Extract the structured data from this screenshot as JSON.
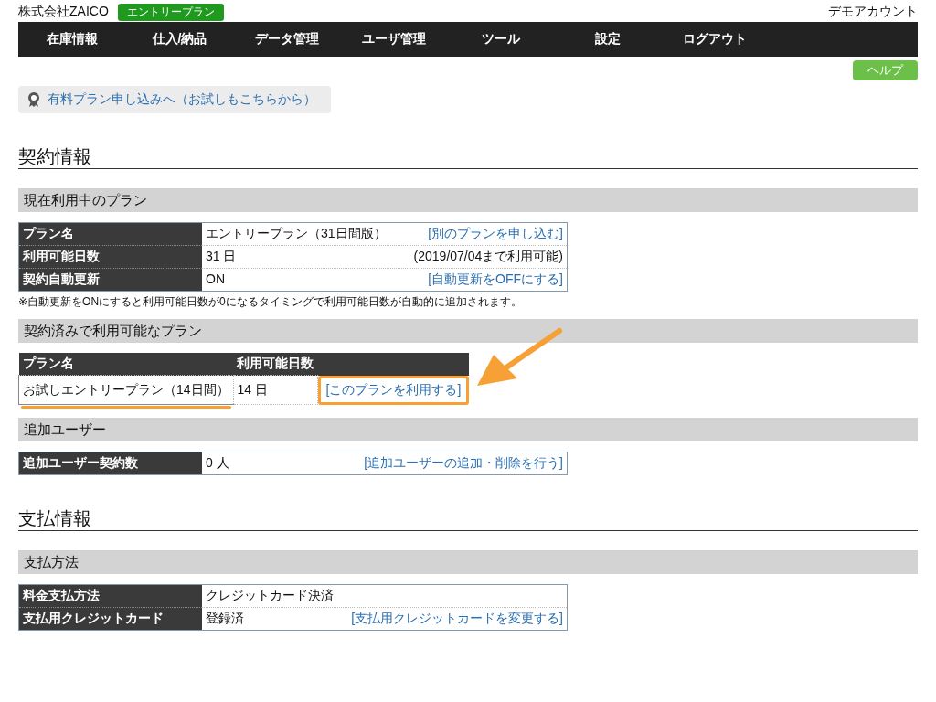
{
  "header": {
    "company": "株式会社ZAICO",
    "plan_badge": "エントリープラン",
    "account": "デモアカウント"
  },
  "nav": [
    {
      "label": "在庫情報"
    },
    {
      "label": "仕入/納品"
    },
    {
      "label": "データ管理"
    },
    {
      "label": "ユーザ管理"
    },
    {
      "label": "ツール"
    },
    {
      "label": "設定"
    },
    {
      "label": "ログアウト"
    }
  ],
  "help_button": "ヘルプ",
  "promo_link": "有料プラン申し込みへ（お試しもこちらから）",
  "sections": [
    {
      "title": "契約情報",
      "blocks": [
        {
          "kind": "kv",
          "title": "現在利用中のプラン",
          "rows": [
            {
              "label": "プラン名",
              "value": "エントリープラン（31日間版）",
              "action": {
                "kind": "link",
                "text": "[別のプランを申し込む]"
              }
            },
            {
              "label": "利用可能日数",
              "value": "31 日",
              "action": {
                "kind": "note",
                "text": "(2019/07/04まで利用可能)"
              }
            },
            {
              "label": "契約自動更新",
              "value": "ON",
              "action": {
                "kind": "link",
                "text": "[自動更新をOFFにする]"
              }
            }
          ],
          "footnote": "※自動更新をONにすると利用可能日数が0になるタイミングで利用可能日数が自動的に追加されます。"
        },
        {
          "kind": "grid",
          "title": "契約済みで利用可能なプラン",
          "columns": [
            "プラン名",
            "利用可能日数"
          ],
          "rows": [
            {
              "name": "お試しエントリープラン（14日間）",
              "days": "14 日",
              "link": "[このプランを利用する]",
              "highlighted": true
            }
          ]
        },
        {
          "kind": "kv",
          "title": "追加ユーザー",
          "rows": [
            {
              "label": "追加ユーザー契約数",
              "value": "0 人",
              "action": {
                "kind": "link",
                "text": "[追加ユーザーの追加・削除を行う]"
              }
            }
          ]
        }
      ]
    },
    {
      "title": "支払情報",
      "blocks": [
        {
          "kind": "kv",
          "title": "支払方法",
          "rows": [
            {
              "label": "料金支払方法",
              "value": "クレジットカード決済"
            },
            {
              "label": "支払用クレジットカード",
              "value": "登録済",
              "action": {
                "kind": "link",
                "text": "[支払用クレジットカードを変更する]"
              }
            }
          ]
        }
      ]
    }
  ]
}
